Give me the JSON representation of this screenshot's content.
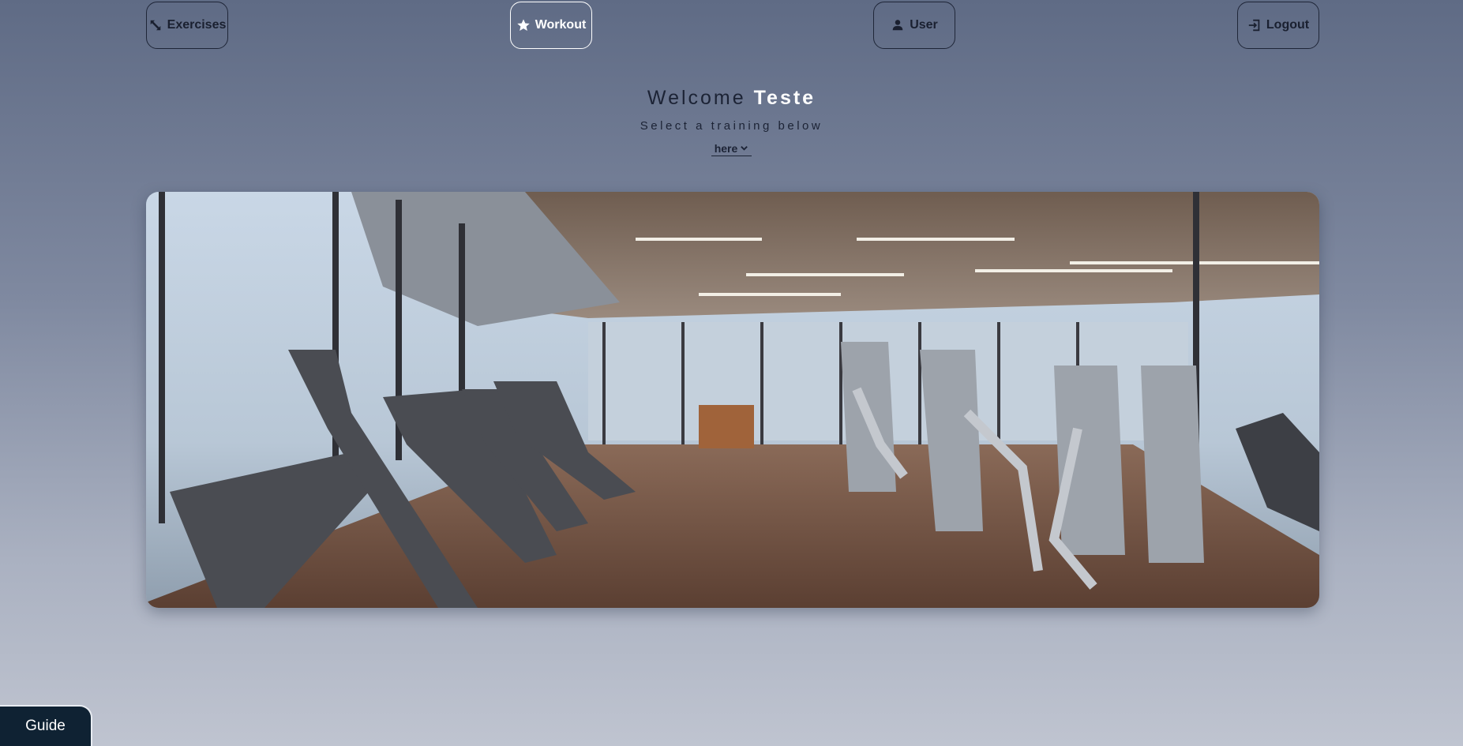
{
  "nav": {
    "exercises": {
      "label": "Exercises",
      "icon": "arrows-diagonal-icon"
    },
    "workout": {
      "label": "Workout",
      "icon": "star-icon",
      "active": true
    },
    "user": {
      "label": "User",
      "icon": "person-icon"
    },
    "logout": {
      "label": "Logout",
      "icon": "logout-icon"
    }
  },
  "hero_text": {
    "welcome": "Welcome",
    "username": "Teste",
    "subtitle": "Select a training below",
    "dropdown_label": "here"
  },
  "hero_image": {
    "subject": "gym interior with cardio machines and strength equipment"
  },
  "guide": {
    "label": "Guide"
  },
  "colors": {
    "background_top": "#5f6b85",
    "background_bottom": "#bfc4d0",
    "text_dark": "#1c2335",
    "active_white": "#ffffff",
    "guide_bg": "#0f2233"
  }
}
